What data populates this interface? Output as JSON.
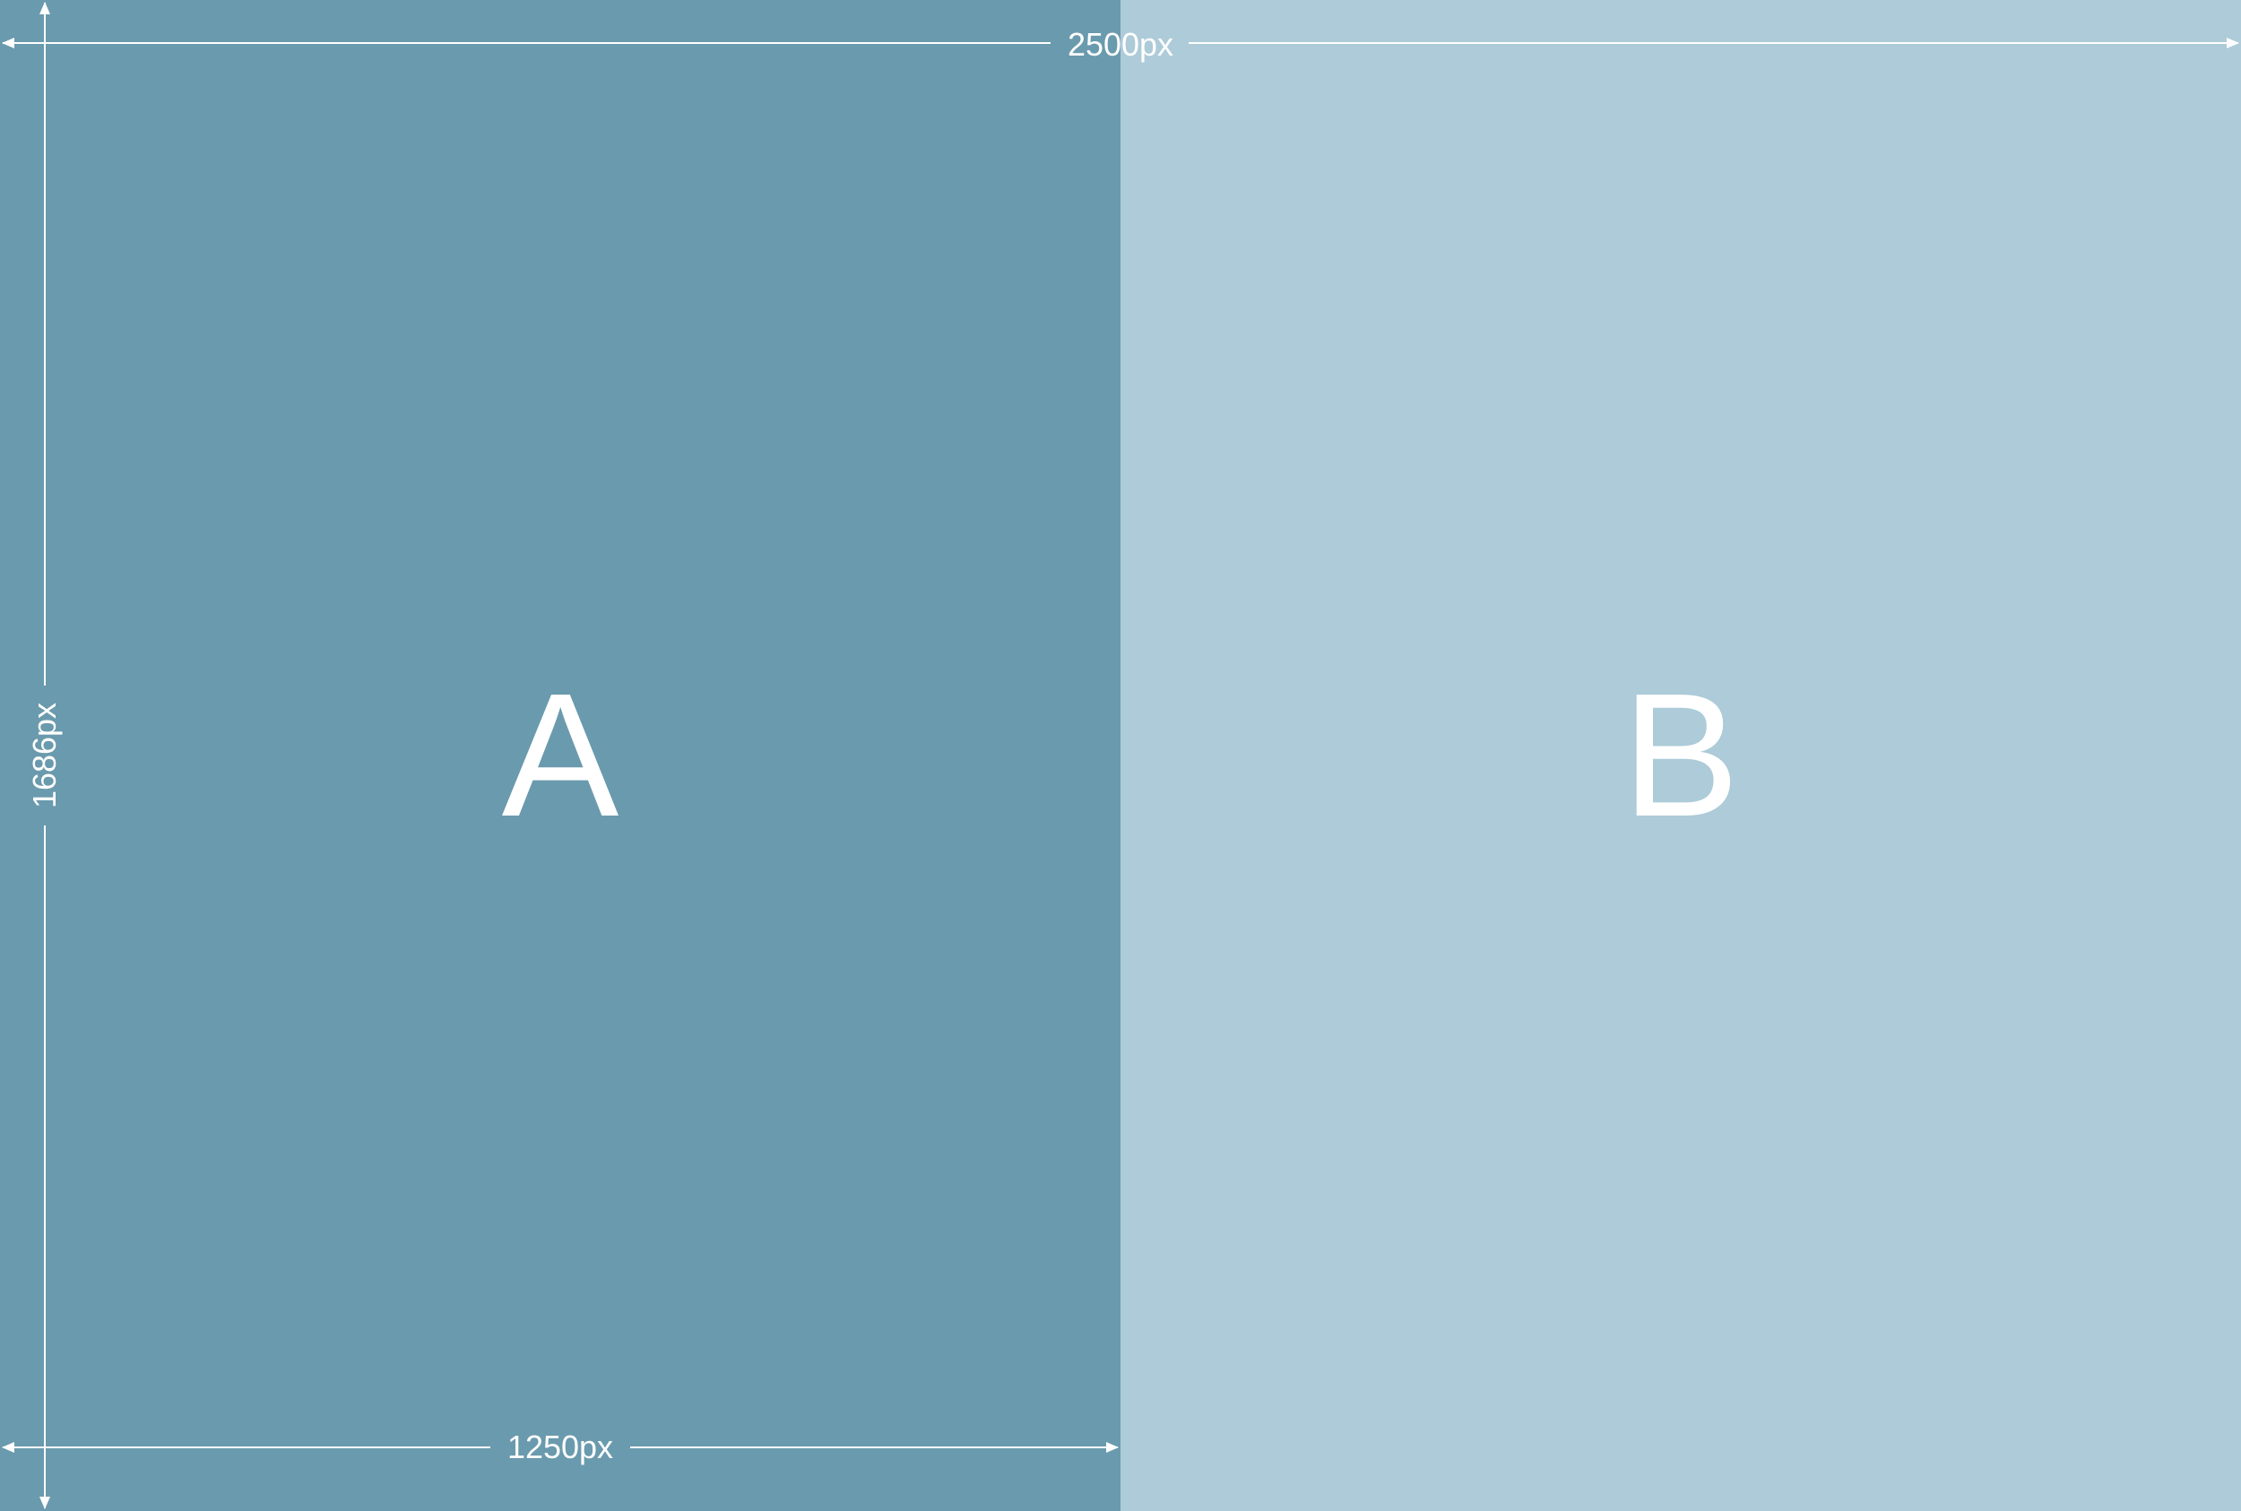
{
  "colors": {
    "panel_a": "#6a9aad",
    "panel_b": "#adcbd8",
    "foreground": "#ffffff"
  },
  "panels": [
    {
      "label": "A"
    },
    {
      "label": "B"
    }
  ],
  "dimensions": {
    "width_label": "2500px",
    "height_label": "1686px",
    "panel_width_label": "1250px"
  }
}
